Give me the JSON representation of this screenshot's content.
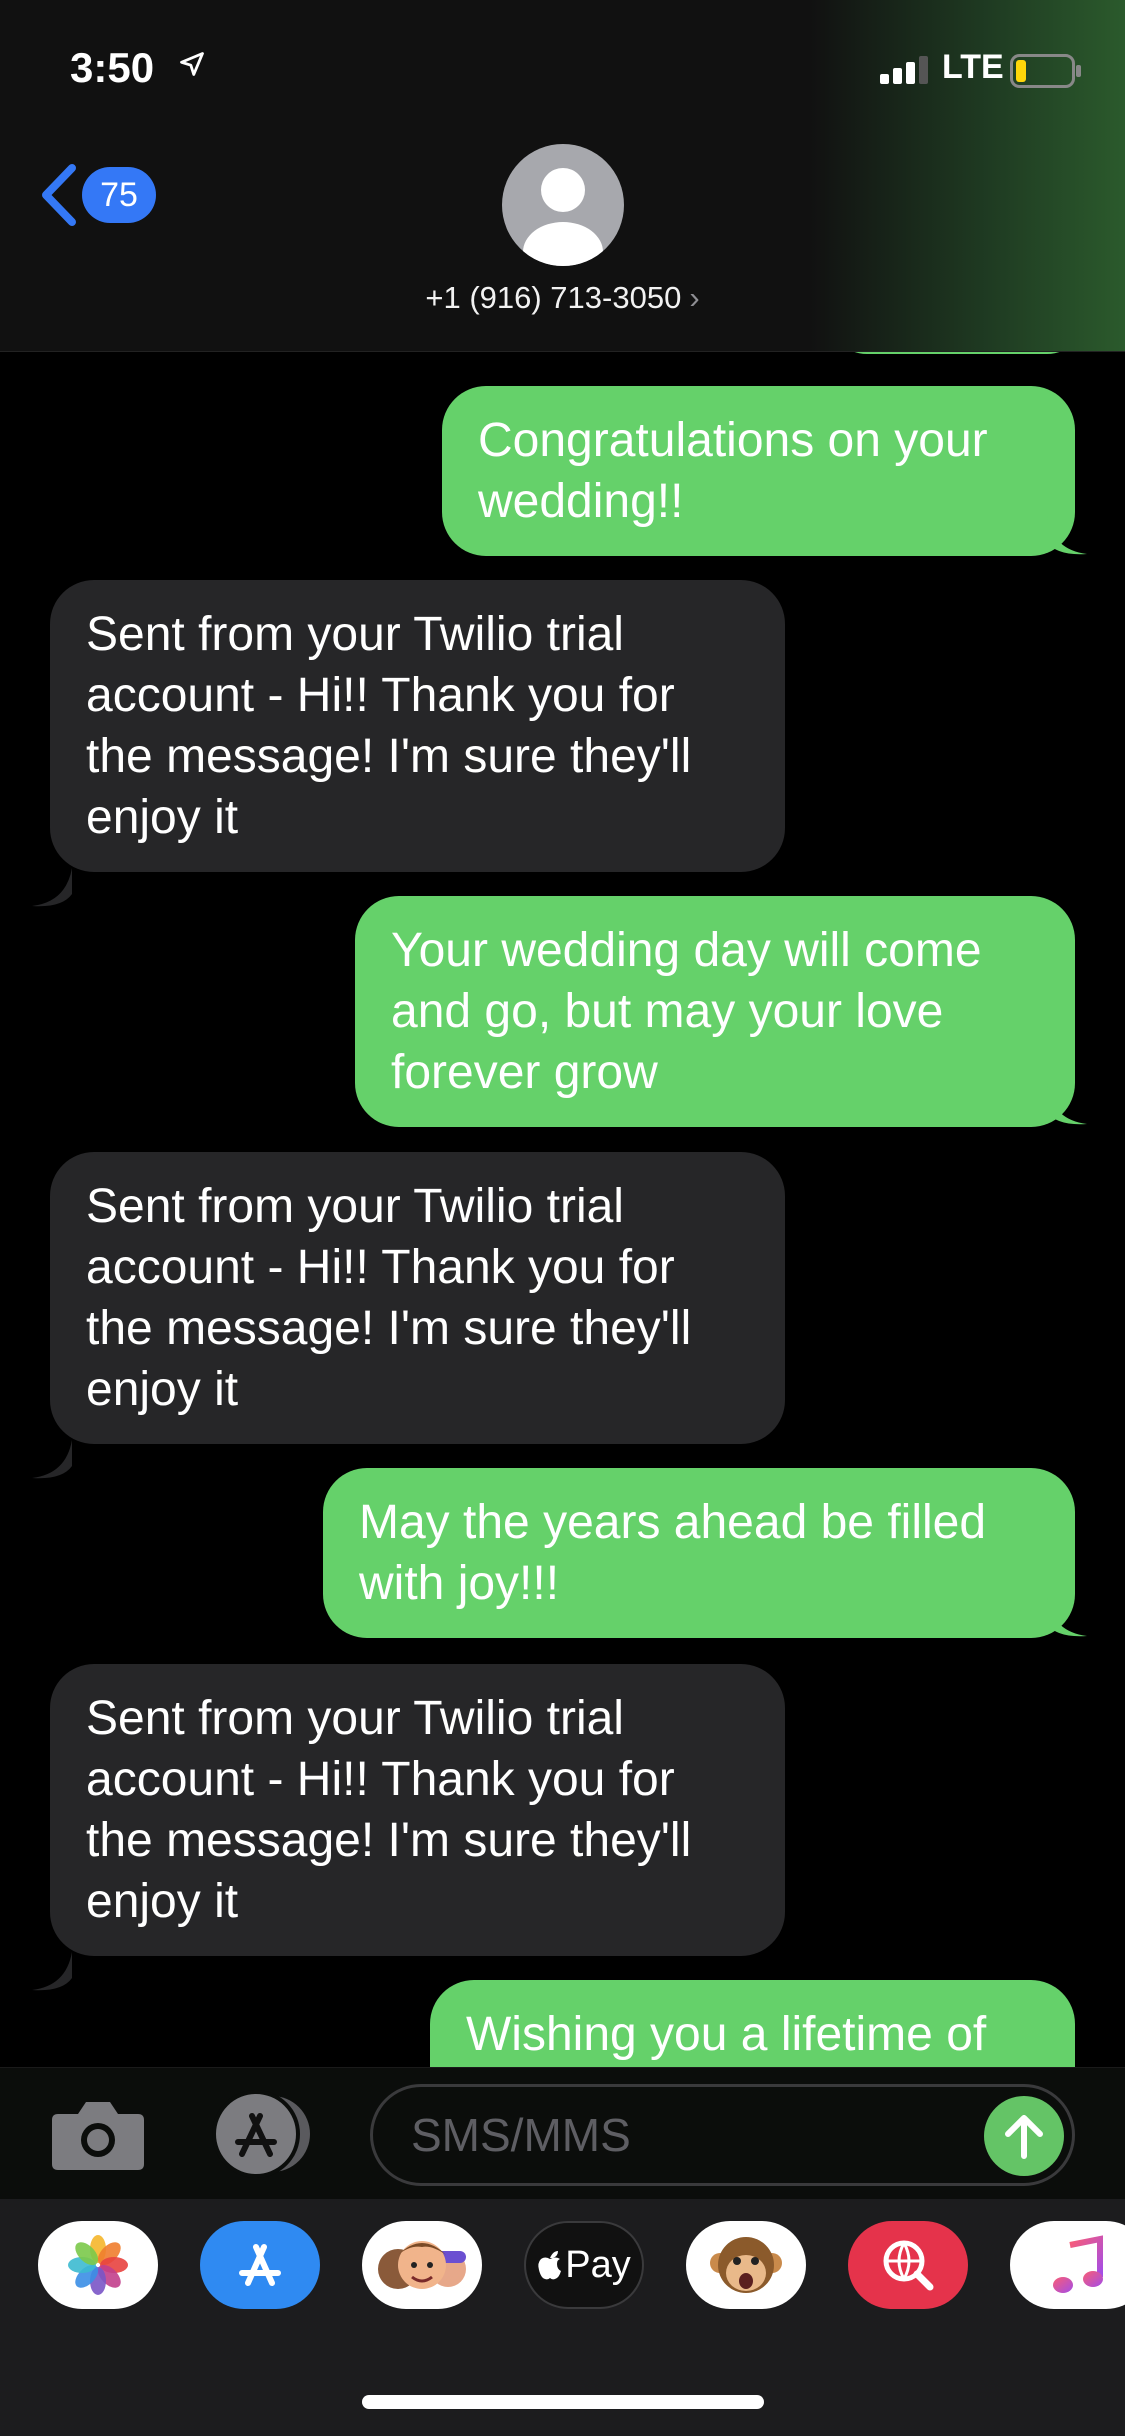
{
  "status_bar": {
    "time": "3:50",
    "network": "LTE",
    "icons": [
      "location-arrow-icon",
      "signal-bars-icon",
      "battery-low-icon"
    ]
  },
  "header": {
    "back_badge": "75",
    "contact_number": "+1 (916) 713-3050",
    "chevron": "›"
  },
  "messages": [
    {
      "direction": "outgoing",
      "text": "Congratulations on your wedding!!"
    },
    {
      "direction": "incoming",
      "text": "Sent from your Twilio trial account - Hi!! Thank you for the message! I'm sure they'll enjoy it"
    },
    {
      "direction": "outgoing",
      "text": "Your wedding day will come and go, but may your love forever grow"
    },
    {
      "direction": "incoming",
      "text": "Sent from your Twilio trial account - Hi!! Thank you for the message! I'm sure they'll enjoy it"
    },
    {
      "direction": "outgoing",
      "text": "May the years ahead be filled with joy!!!"
    },
    {
      "direction": "incoming",
      "text": "Sent from your Twilio trial account - Hi!! Thank you for the message! I'm sure they'll enjoy it"
    },
    {
      "direction": "outgoing",
      "text": "Wishing you a lifetime of"
    }
  ],
  "composer": {
    "placeholder": "SMS/MMS"
  },
  "app_drawer": {
    "apps": [
      {
        "name": "photos-app-icon"
      },
      {
        "name": "app-store-icon"
      },
      {
        "name": "memoji-stickers-icon"
      },
      {
        "name": "apple-pay-icon",
        "label": "Pay"
      },
      {
        "name": "animoji-icon"
      },
      {
        "name": "image-search-icon"
      },
      {
        "name": "music-icon"
      }
    ]
  },
  "colors": {
    "outgoing_bubble": "#65d16a",
    "incoming_bubble": "#262628",
    "accent_blue": "#3478f6",
    "send_green": "#64c466"
  }
}
